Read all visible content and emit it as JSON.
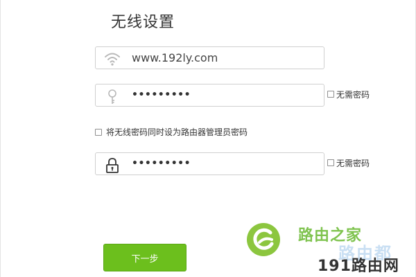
{
  "page": {
    "title": "无线设置"
  },
  "wifi_name": {
    "value": "www.192ly.com",
    "icon": "wifi-icon"
  },
  "wifi_password": {
    "value": "•••••••••",
    "icon": "key-icon",
    "no_password_label": "无需密码"
  },
  "sync_admin": {
    "label": "将无线密码同时设为路由器管理员密码",
    "checked": false
  },
  "admin_password": {
    "value": "•••••••••",
    "icon": "lock-icon",
    "no_password_label": "无需密码"
  },
  "next_button": {
    "label": "下一步",
    "color": "#6cbf1d"
  },
  "watermark": {
    "line1": "路由之家",
    "line2": "路由都",
    "line3": "191路由网"
  }
}
